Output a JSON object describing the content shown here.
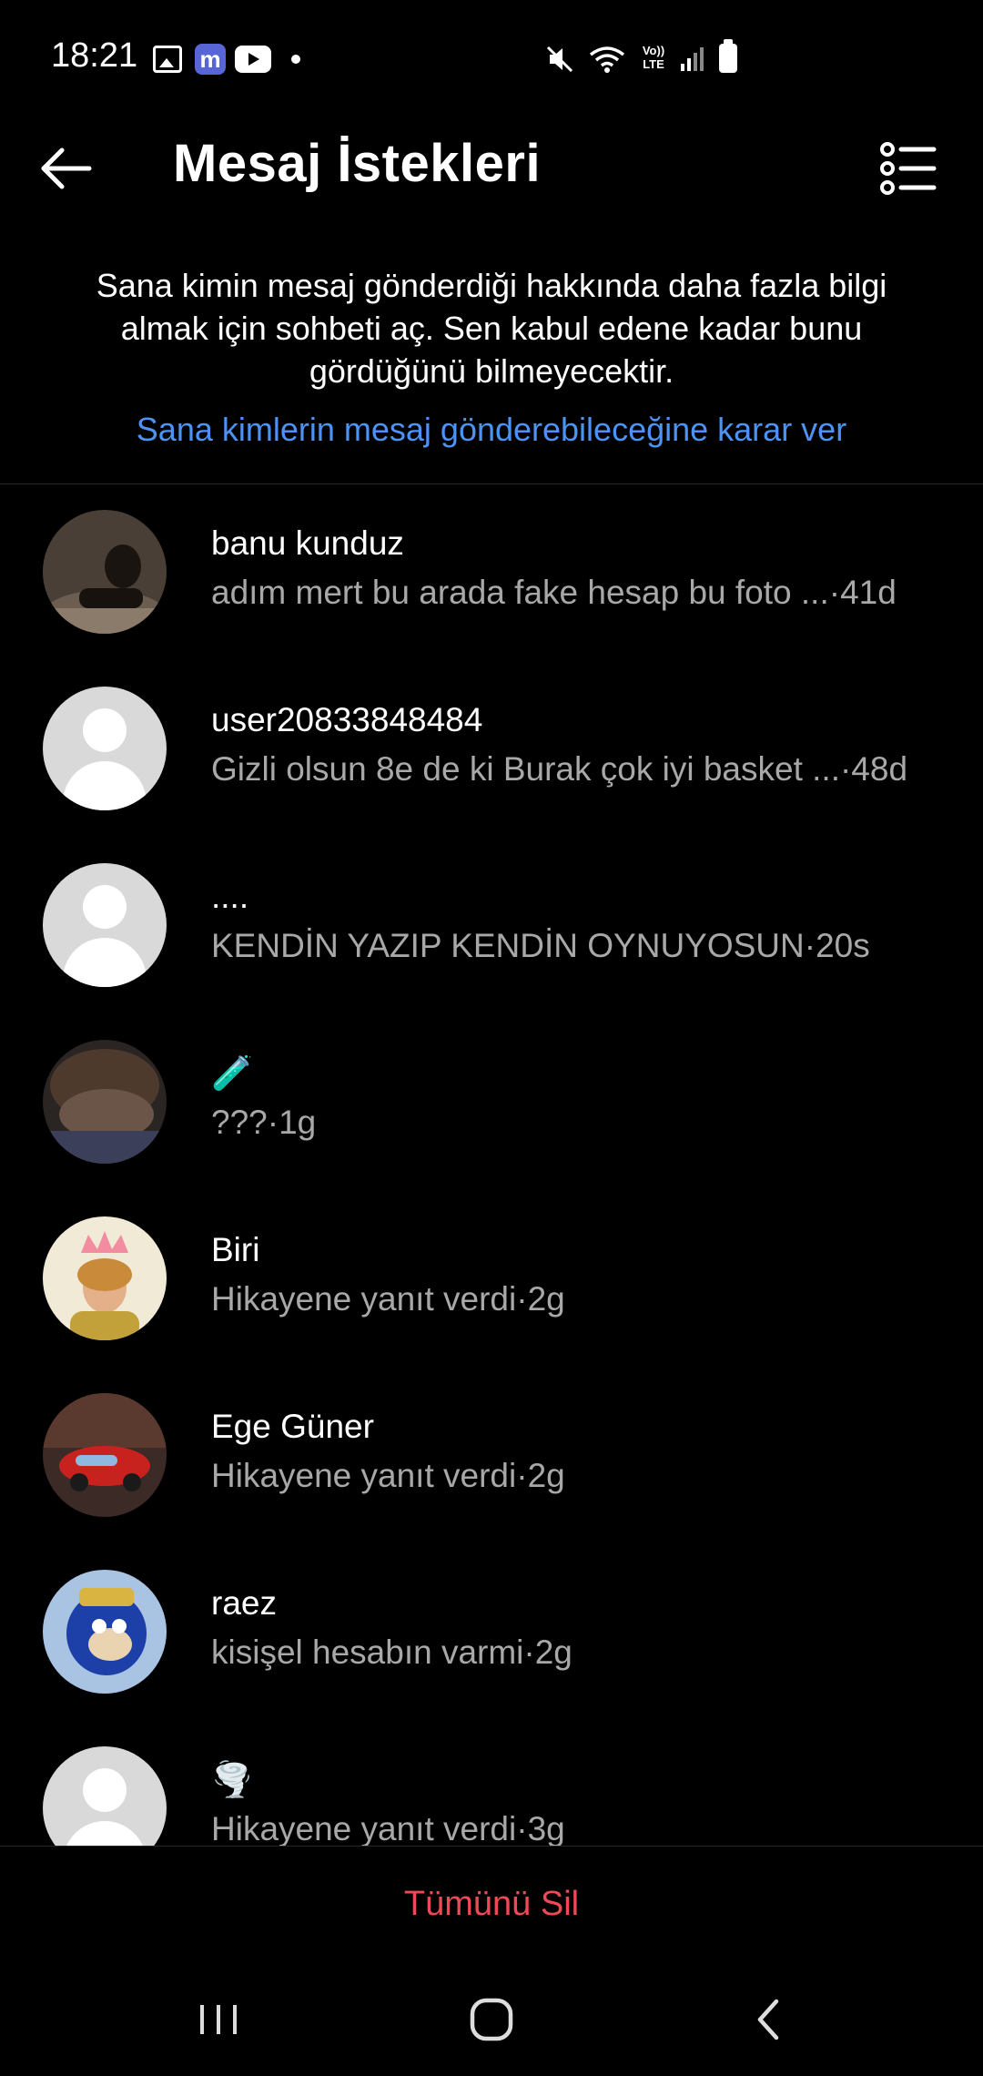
{
  "status_bar": {
    "time": "18:21",
    "left_icons": [
      "gallery-icon",
      "mastodon-icon",
      "youtube-icon",
      "dot-icon"
    ],
    "right_icons": [
      "mute-icon",
      "wifi-icon",
      "volte-icon",
      "signal-icon",
      "battery-icon"
    ],
    "volte_text": "Vo)) LTE",
    "mastodon_letter": "m"
  },
  "header": {
    "title": "Mesaj İstekleri",
    "back_icon": "arrow-left-icon",
    "menu_icon": "list-menu-icon"
  },
  "intro": {
    "text": "Sana kimin mesaj gönderdiği hakkında daha fazla bilgi almak için sohbeti aç. Sen kabul edene kadar bunu gördüğünü bilmeyecektir.",
    "link": "Sana kimlerin mesaj gönderebileceğine karar ver"
  },
  "requests": [
    {
      "name": "banu kunduz",
      "message": "adım mert bu arada fake hesap bu foto ...",
      "time": "41d",
      "avatar": "photo-dark"
    },
    {
      "name": "user20833848484",
      "message": "Gizli olsun 8e de ki Burak çok iyi basket ...",
      "time": "48d",
      "avatar": "default"
    },
    {
      "name": "....",
      "message": "KENDİN YAZIP KENDİN OYNUYOSUN",
      "time": "20s",
      "avatar": "default"
    },
    {
      "name": "🧪",
      "message": "???",
      "time": "1g",
      "avatar": "photo-brown"
    },
    {
      "name": "Biri",
      "message": "Hikayene yanıt verdi",
      "time": "2g",
      "avatar": "photo-crown"
    },
    {
      "name": "Ege Güner",
      "message": "Hikayene yanıt verdi",
      "time": "2g",
      "avatar": "photo-car"
    },
    {
      "name": "raez",
      "message": "kisişel hesabın varmi",
      "time": "2g",
      "avatar": "photo-blue"
    },
    {
      "name": "🌪️",
      "message": "Hikayene yanıt verdi",
      "time": "3g",
      "avatar": "default"
    }
  ],
  "separator": " · ",
  "bottom": {
    "delete_all": "Tümünü Sil"
  },
  "nav": {
    "recents_icon": "recents-icon",
    "home_icon": "home-icon",
    "back_icon": "nav-back-icon"
  },
  "colors": {
    "background": "#000000",
    "link": "#4c93f5",
    "danger": "#ed4956",
    "secondary_text": "#a8a8a8"
  }
}
